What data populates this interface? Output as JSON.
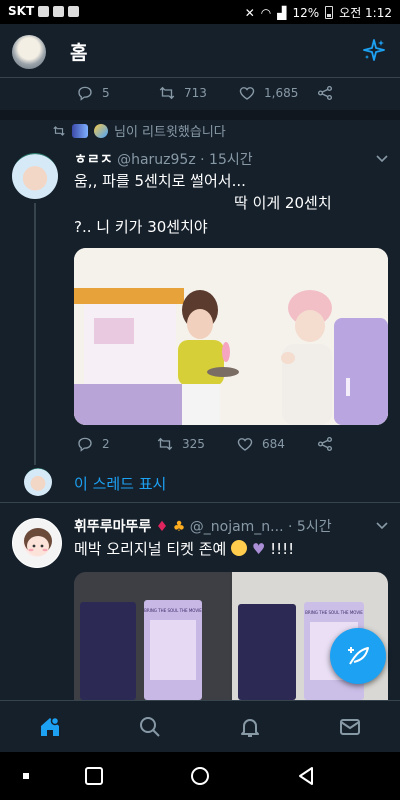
{
  "status_bar": {
    "carrier": "SKT",
    "battery": "12%",
    "time": "오전 1:12"
  },
  "header": {
    "title": "홈"
  },
  "prev_tweet_actions": {
    "replies": "5",
    "retweets": "713",
    "likes": "1,685"
  },
  "retweet_context": {
    "text": "님이 리트윗했습니다"
  },
  "tweet1": {
    "name": "ㅎㄹㅈ",
    "handle": "@haruz95z",
    "time": "15시간",
    "line1": "움,, 파를 5센치로 썰어서...",
    "line2": "딱 이게 20센치",
    "line3": "?.. 니 키가 30센치야",
    "replies": "2",
    "retweets": "325",
    "likes": "684"
  },
  "show_thread": {
    "label": "이 스레드 표시"
  },
  "tweet2": {
    "name": "휘뚜루마뚜루",
    "handle": "@_nojam_n...",
    "time": "5시간",
    "text": "메박 오리지널 티켓 존예",
    "text_tail": "!!!!",
    "ticket_title": "BRING THE SOUL THE MOVIE"
  },
  "colors": {
    "background": "#15202b",
    "accent": "#1da1f2",
    "muted": "#8899a6",
    "divider": "#38444d"
  },
  "icons": {
    "compose": "sparkle-icon",
    "fab": "feather-icon",
    "tabs": [
      "home-icon",
      "search-icon",
      "bell-icon",
      "mail-icon"
    ]
  }
}
